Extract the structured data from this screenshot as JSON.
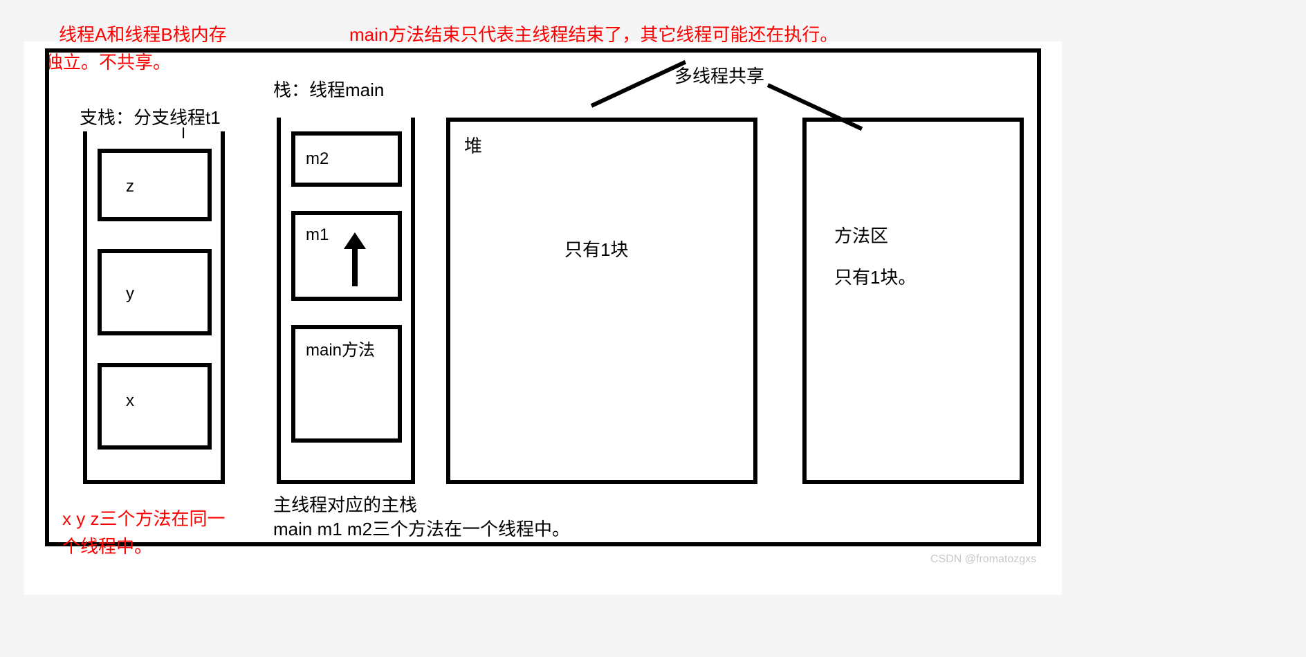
{
  "annotations": {
    "top_left_red_1": "线程A和线程B栈内存",
    "top_left_red_2": "独立。不共享。",
    "top_right_red": "main方法结束只代表主线程结束了，其它线程可能还在执行。",
    "bottom_left_red_1": "x y z三个方法在同一",
    "bottom_left_red_2": "个线程中。"
  },
  "labels": {
    "branch_stack_title": "支栈：分支线程t1",
    "main_stack_title": "栈：线程main",
    "shared_title": "多线程共享",
    "main_stack_caption_1": "主线程对应的主栈",
    "main_stack_caption_2": "main m1 m2三个方法在一个线程中。"
  },
  "branch_stack_frames": {
    "f0": "z",
    "f1": "y",
    "f2": "x"
  },
  "main_stack_frames": {
    "f0": "m2",
    "f1": "m1",
    "f2": "main方法"
  },
  "heap": {
    "title": "堆",
    "content": "只有1块"
  },
  "method_area": {
    "title": "方法区",
    "content": "只有1块。"
  },
  "watermark": "CSDN @fromatozgxs"
}
